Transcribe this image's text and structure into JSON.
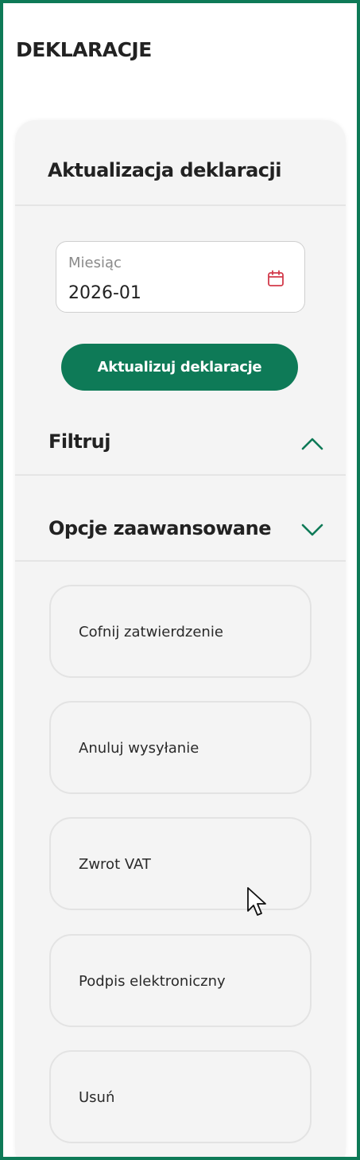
{
  "header": {
    "title": "DEKLARACJE"
  },
  "panel": {
    "title": "Aktualizacja deklaracji",
    "month_field": {
      "label": "Miesiąc",
      "value": "2026-01",
      "icon": "calendar-icon"
    },
    "update_button_label": "Aktualizuj deklaracje"
  },
  "sections": {
    "filter": {
      "title": "Filtruj",
      "expanded": true
    },
    "advanced": {
      "title": "Opcje zaawansowane",
      "expanded": false
    }
  },
  "options": [
    {
      "label": "Cofnij zatwierdzenie"
    },
    {
      "label": "Anuluj wysyłanie"
    },
    {
      "label": "Zwrot VAT"
    },
    {
      "label": "Podpis elektroniczny"
    },
    {
      "label": "Usuń"
    }
  ],
  "colors": {
    "accent": "#0e7a57",
    "calendar_icon": "#d23a4a",
    "panel_bg": "#f4f4f4",
    "text": "#222222"
  }
}
